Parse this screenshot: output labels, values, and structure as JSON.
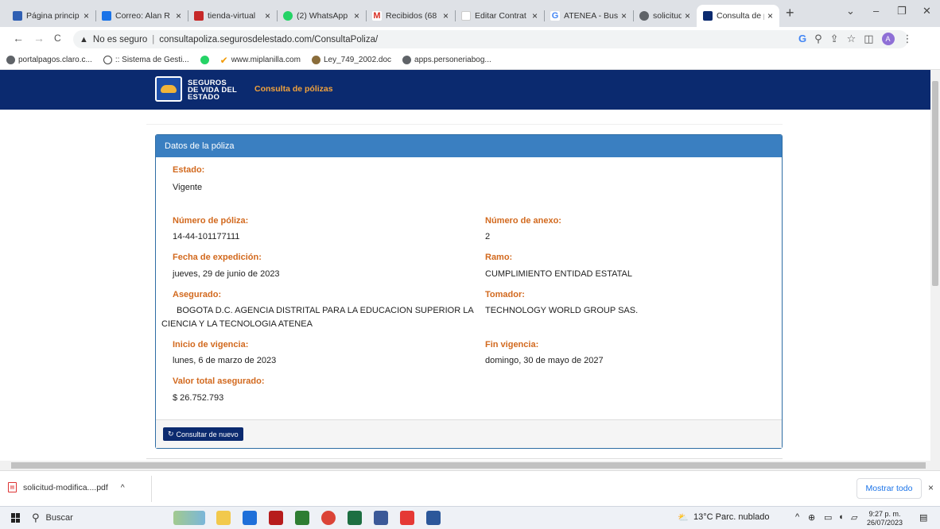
{
  "browser": {
    "tabs": [
      {
        "title": "Página princip",
        "fav_color": "#2f5fb3"
      },
      {
        "title": "Correo: Alan R",
        "fav_color": "#1a73e8"
      },
      {
        "title": "tienda-virtual",
        "fav_color": "#c62828"
      },
      {
        "title": "(2) WhatsApp",
        "fav_color": "#25d366"
      },
      {
        "title": "Recibidos (68",
        "fav_color": "#d93025"
      },
      {
        "title": "Editar Contrat",
        "fav_color": "#ffffff"
      },
      {
        "title": "ATENEA - Bus",
        "fav_color": "#4285f4"
      },
      {
        "title": "solicitud-mod",
        "fav_color": "#5f6368"
      },
      {
        "title": "Consulta de p",
        "fav_color": "#0b2a6f"
      }
    ],
    "close_glyph": "×",
    "new_tab": "+",
    "window_controls": {
      "chevron": "⌄",
      "minimize": "–",
      "maximize": "❐",
      "close": "✕"
    },
    "address": {
      "security_label": "No es seguro",
      "url": "consultapoliza.segurosdelestado.com/ConsultaPoliza/"
    },
    "nav": {
      "back": "←",
      "forward": "→",
      "reload": "C"
    },
    "toolbar_icons": {
      "google": "G",
      "zoom": "⚲",
      "share": "⇪",
      "star": "☆",
      "sidebar": "◫",
      "menu": "⋮"
    },
    "profile_initial": "A",
    "bookmarks": [
      {
        "label": "portalpagos.claro.c...",
        "color": "#5f6368"
      },
      {
        "label": ":: Sistema de Gesti...",
        "color": "#444444"
      },
      {
        "label": "",
        "color": "#25d366"
      },
      {
        "label": "www.miplanilla.com",
        "color": "#f29900"
      },
      {
        "label": "Ley_749_2002.doc",
        "color": "#8a6d3b"
      },
      {
        "label": "apps.personeriabog...",
        "color": "#5f6368"
      }
    ]
  },
  "site": {
    "brand_line1": "SEGUROS",
    "brand_line2": "DE VIDA DEL",
    "brand_line3": "ESTADO",
    "nav_label": "Consulta de pólizas"
  },
  "policy_panel": {
    "heading": "Datos de la póliza",
    "estado_label": "Estado:",
    "estado_value": "Vigente",
    "numero_poliza_label": "Número de póliza:",
    "numero_poliza_value": "14-44-101177111",
    "numero_anexo_label": "Número de anexo:",
    "numero_anexo_value": "2",
    "fecha_expedicion_label": "Fecha de expedición:",
    "fecha_expedicion_value": "jueves, 29 de junio de 2023",
    "ramo_label": "Ramo:",
    "ramo_value": "CUMPLIMIENTO ENTIDAD ESTATAL",
    "asegurado_label": "Asegurado:",
    "asegurado_line1": "BOGOTA D.C. AGENCIA DISTRITAL PARA LA EDUCACION SUPERIOR LA",
    "asegurado_line2": "CIENCIA Y LA TECNOLOGIA ATENEA",
    "tomador_label": "Tomador:",
    "tomador_value": "TECHNOLOGY WORLD GROUP SAS.",
    "inicio_label": "Inicio de vigencia:",
    "inicio_value": "lunes, 6 de marzo de 2023",
    "fin_label": "Fin vigencia:",
    "fin_value": "domingo, 30 de mayo de 2027",
    "valor_label": "Valor total asegurado:",
    "valor_value": "$ 26.752.793",
    "button_label": "Consultar de nuevo",
    "button_icon": "↻"
  },
  "downloads": {
    "file_name": "solicitud-modifica....pdf",
    "chevron": "^",
    "show_all": "Mostrar todo",
    "close": "×"
  },
  "taskbar": {
    "search_placeholder": "Buscar",
    "weather": "13°C  Parc. nublado",
    "time": "9:27 p. m.",
    "date": "26/07/2023",
    "apps": [
      {
        "name": "explorer",
        "color": "#f2c94c"
      },
      {
        "name": "mail",
        "color": "#1e6fd9"
      },
      {
        "name": "media",
        "color": "#b71c1c"
      },
      {
        "name": "xbox",
        "color": "#2e7d32"
      },
      {
        "name": "chrome",
        "color": "#db4437"
      },
      {
        "name": "excel",
        "color": "#1d6f42"
      },
      {
        "name": "calculator",
        "color": "#3b5998"
      },
      {
        "name": "acrobat",
        "color": "#e53935"
      },
      {
        "name": "word",
        "color": "#2b579a"
      }
    ]
  }
}
